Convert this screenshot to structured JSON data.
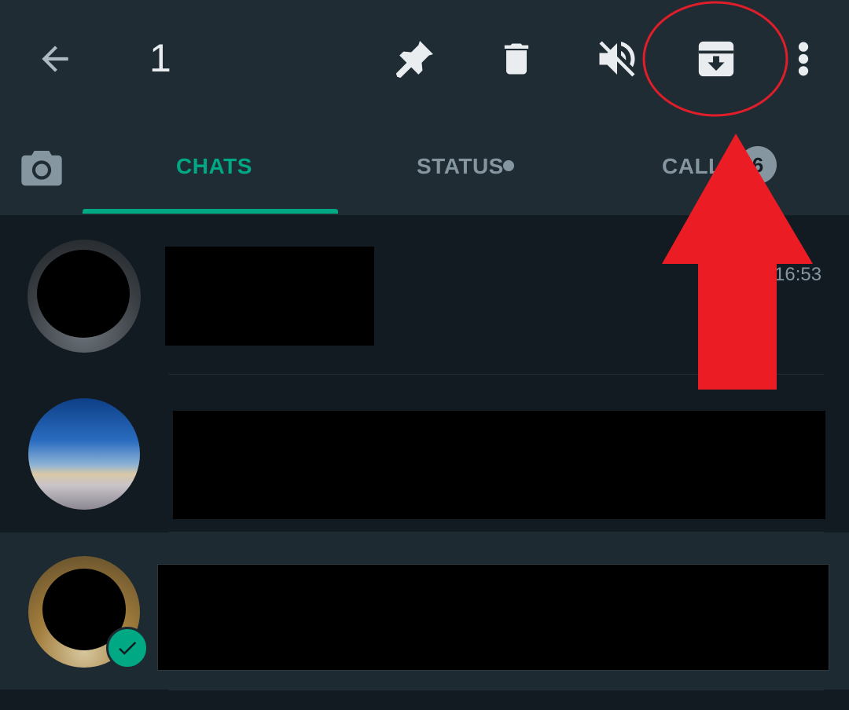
{
  "topbar": {
    "selected_count": "1",
    "back_icon": "arrow-back-icon",
    "actions": [
      {
        "name": "pin",
        "icon": "pin-icon"
      },
      {
        "name": "delete",
        "icon": "trash-icon"
      },
      {
        "name": "mute",
        "icon": "mute-icon"
      },
      {
        "name": "archive",
        "icon": "archive-icon"
      },
      {
        "name": "more",
        "icon": "more-vert-icon"
      }
    ]
  },
  "tabs": {
    "camera_icon": "camera-icon",
    "items": [
      {
        "label": "CHATS",
        "active": true
      },
      {
        "label": "STATUS",
        "active": false
      },
      {
        "label": "CALLS",
        "active": false
      }
    ],
    "calls_badge": "6"
  },
  "chats": [
    {
      "time": "16:53"
    },
    {
      "time": ""
    },
    {
      "time": "",
      "selected": true
    }
  ],
  "colors": {
    "accent": "#00a884",
    "annotation": "#ec1c24",
    "bar": "#1f2c34",
    "background": "#121b22"
  }
}
